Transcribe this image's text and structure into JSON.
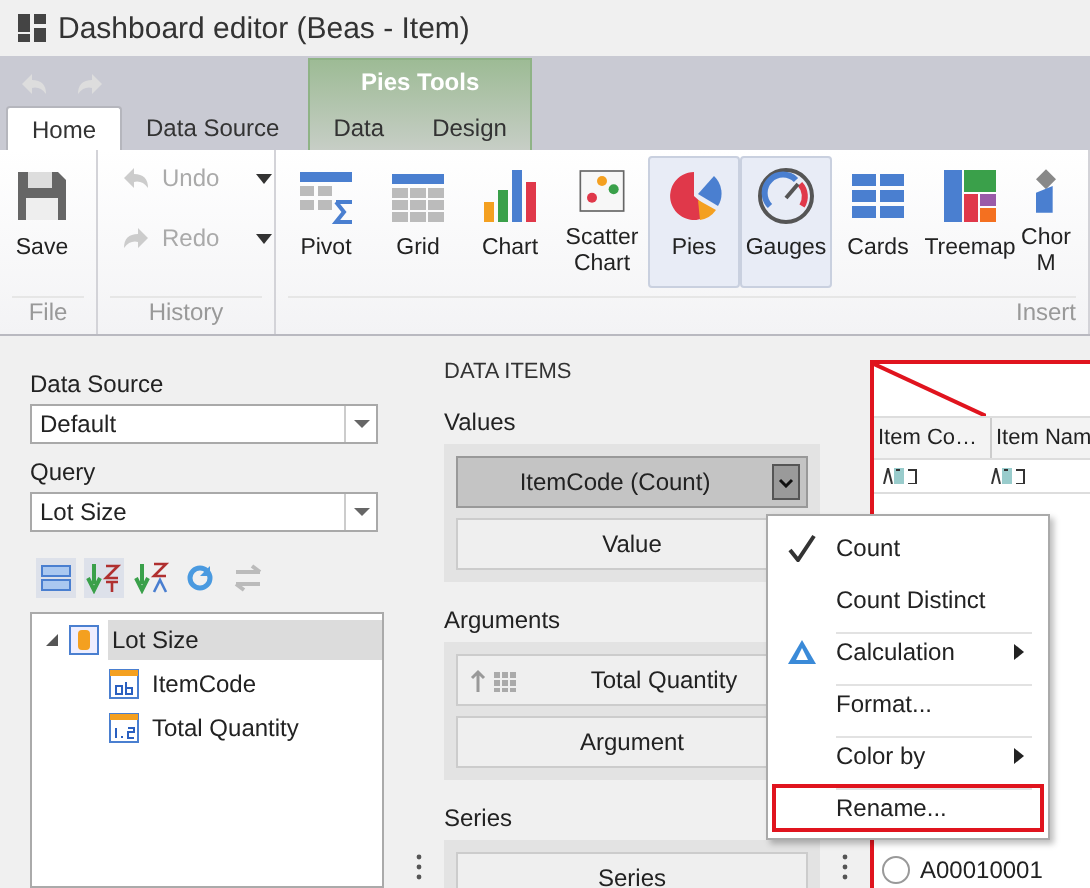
{
  "window": {
    "title": "Dashboard editor (Beas - Item)"
  },
  "context_group": {
    "title": "Pies Tools"
  },
  "tabs": [
    {
      "label": "Home",
      "selected": true,
      "contextual": false
    },
    {
      "label": "Data Source",
      "selected": false,
      "contextual": false
    },
    {
      "label": "Data",
      "selected": false,
      "contextual": true
    },
    {
      "label": "Design",
      "selected": false,
      "contextual": true
    }
  ],
  "file_group": {
    "title": "File",
    "button": {
      "label": "Save"
    }
  },
  "history_group": {
    "title": "History",
    "buttons": [
      {
        "label": "Undo",
        "disabled": true,
        "kind": "undo"
      },
      {
        "label": "Redo",
        "disabled": true,
        "kind": "redo"
      }
    ]
  },
  "insert_group": {
    "title": "Insert",
    "buttons": [
      {
        "label": "Pivot",
        "kind": "pivot",
        "selected": false
      },
      {
        "label": "Grid",
        "kind": "grid",
        "selected": false
      },
      {
        "label": "Chart",
        "kind": "chart",
        "selected": false
      },
      {
        "label": "Scatter Chart",
        "kind": "scatter",
        "selected": false
      },
      {
        "label": "Pies",
        "kind": "pies",
        "selected": true
      },
      {
        "label": "Gauges",
        "kind": "gauges",
        "selected": true
      },
      {
        "label": "Cards",
        "kind": "cards",
        "selected": false
      },
      {
        "label": "Treemap",
        "kind": "treemap",
        "selected": false
      },
      {
        "label": "Chor M",
        "kind": "map",
        "selected": false
      }
    ]
  },
  "data_source": {
    "label": "Data Source",
    "value": "Default"
  },
  "query": {
    "label": "Query",
    "value": "Lot Size"
  },
  "field_tree": [
    {
      "label": "Lot Size",
      "kind": "table",
      "expanded": true,
      "selected": true,
      "children": [
        {
          "label": "ItemCode",
          "kind": "text",
          "selected": false
        },
        {
          "label": "Total Quantity",
          "kind": "number",
          "selected": false
        }
      ]
    }
  ],
  "data_items": {
    "title": "DATA ITEMS",
    "sections": [
      {
        "label": "Values",
        "items": [
          {
            "label": "ItemCode (Count)",
            "kind": "measure"
          },
          {
            "label": "Value",
            "kind": "placeholder"
          }
        ]
      },
      {
        "label": "Arguments",
        "items": [
          {
            "label": "Total Quantity",
            "kind": "dimension"
          },
          {
            "label": "Argument",
            "kind": "placeholder"
          }
        ]
      },
      {
        "label": "Series",
        "items": [
          {
            "label": "Series",
            "kind": "placeholder"
          }
        ]
      }
    ]
  },
  "preview": {
    "columns": [
      "Item Co…",
      "Item Nam"
    ],
    "radio_rows": [
      {
        "label": "A00010001",
        "selected": false
      }
    ]
  },
  "context_menu": [
    {
      "label": "Count",
      "checked": true,
      "submenu": false,
      "highlighted": false,
      "separator_before": false,
      "kind": "plain"
    },
    {
      "label": "Count Distinct",
      "checked": false,
      "submenu": false,
      "highlighted": false,
      "separator_before": false,
      "kind": "plain"
    },
    {
      "label": "Calculation",
      "checked": false,
      "submenu": true,
      "highlighted": false,
      "separator_before": true,
      "kind": "calculation"
    },
    {
      "label": "Format...",
      "checked": false,
      "submenu": false,
      "highlighted": false,
      "separator_before": true,
      "kind": "plain"
    },
    {
      "label": "Color by",
      "checked": false,
      "submenu": true,
      "highlighted": false,
      "separator_before": true,
      "kind": "plain"
    },
    {
      "label": "Rename...",
      "checked": false,
      "submenu": false,
      "highlighted": true,
      "separator_before": true,
      "kind": "plain"
    }
  ]
}
